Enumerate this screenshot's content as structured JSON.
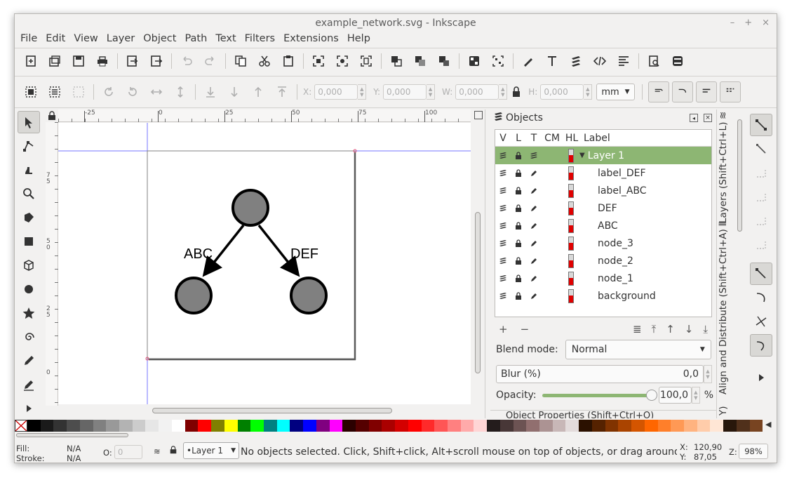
{
  "window": {
    "title": "example_network.svg - Inkscape",
    "minimize": "–",
    "maximize": "+",
    "close": "×"
  },
  "menu": [
    "File",
    "Edit",
    "View",
    "Layer",
    "Object",
    "Path",
    "Text",
    "Filters",
    "Extensions",
    "Help"
  ],
  "controls": {
    "x_label": "X:",
    "x_value": "0,000",
    "y_label": "Y:",
    "y_value": "0,000",
    "w_label": "W:",
    "w_value": "0,000",
    "h_label": "H:",
    "h_value": "0,000",
    "unit": "mm"
  },
  "ruler_top": [
    "-25",
    "0",
    "25",
    "50",
    "75",
    "100"
  ],
  "ruler_left": [
    "7\n5",
    "5\n0",
    "2\n5",
    "0"
  ],
  "drawing": {
    "label_left": "ABC",
    "label_right": "DEF"
  },
  "objects_panel": {
    "title": "Objects",
    "columns": [
      "V",
      "L",
      "T",
      "CM",
      "HL",
      "Label"
    ],
    "rows": [
      "Layer 1",
      "label_DEF",
      "label_ABC",
      "DEF",
      "ABC",
      "node_3",
      "node_2",
      "node_1",
      "background"
    ],
    "blend_label": "Blend mode:",
    "blend_value": "Normal",
    "blur_label": "Blur (%)",
    "blur_value": "0,0",
    "opacity_label": "Opacity:",
    "opacity_value": "100,0",
    "opacity_unit": "%",
    "opacity_level": 1.0,
    "next_panel": "Object Properties (Shift+Ctrl+O)"
  },
  "side_tabs": {
    "layers": "Layers (Shift+Ctrl+L)",
    "align": "Align and Distribute (Shift+Ctrl+A)",
    "extra": "Y)"
  },
  "status": {
    "fill_label": "Fill:",
    "fill_value": "N/A",
    "stroke_label": "Stroke:",
    "stroke_value": "N/A",
    "opacity_label": "O:",
    "opacity_value": "0",
    "layer": "•Layer 1",
    "message": "No objects selected. Click, Shift+click, Alt+scroll mouse on top of objects, or drag around o…",
    "x_label": "X:",
    "x_value": "120,90",
    "y_label": "Y:",
    "y_value": "87,05",
    "zoom_label": "Z:",
    "zoom_value": "98%"
  },
  "colors": {
    "selected_row": "#8db673",
    "guide": "#3a3aff",
    "node_fill": "#808080"
  },
  "palette": [
    "#000000",
    "#1a1a1a",
    "#333333",
    "#4d4d4d",
    "#666666",
    "#808080",
    "#999999",
    "#b3b3b3",
    "#cccccc",
    "#e6e6e6",
    "#f2f2f2",
    "#ffffff",
    "#800000",
    "#ff0000",
    "#808000",
    "#ffff00",
    "#008000",
    "#00ff00",
    "#008080",
    "#00ffff",
    "#000080",
    "#0000ff",
    "#800080",
    "#ff00ff",
    "#2b0000",
    "#550000",
    "#800000",
    "#aa0000",
    "#d40000",
    "#ff0000",
    "#ff2a2a",
    "#ff5555",
    "#ff8080",
    "#ffaaaa",
    "#ffd5d5",
    "#241c1c",
    "#483737",
    "#6c5353",
    "#916f6f",
    "#ac9393",
    "#c8b7b7",
    "#e3dbdb",
    "#2b1100",
    "#552200",
    "#803300",
    "#aa4400",
    "#d45500",
    "#ff6600",
    "#ff7f2a",
    "#ff9955",
    "#ffb380",
    "#ffccaa",
    "#ffe6d5",
    "#28170b",
    "#50301b",
    "#784421"
  ]
}
